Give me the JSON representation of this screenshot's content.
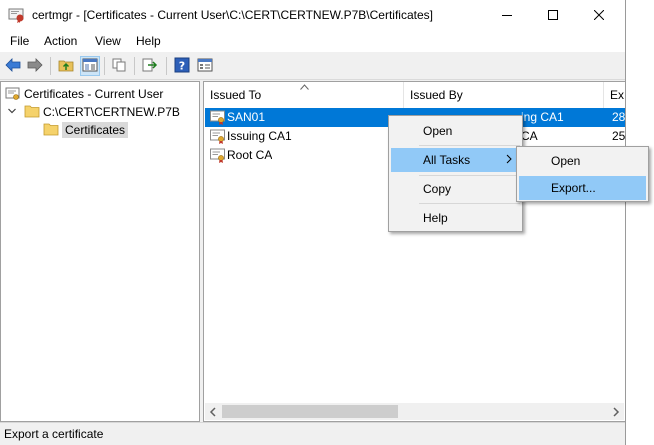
{
  "window": {
    "title": "certmgr - [Certificates - Current User\\C:\\CERT\\CERTNEW.P7B\\Certificates]",
    "controls": [
      "minimize-icon",
      "maximize-icon",
      "close-icon"
    ]
  },
  "menubar": {
    "items": [
      "File",
      "Action",
      "View",
      "Help"
    ]
  },
  "toolbar": {
    "buttons": [
      "back-arrow-icon",
      "forward-arrow-icon",
      "up-folder-icon",
      "show-hide-tree-icon",
      "copy-icon",
      "export-list-icon",
      "help-icon",
      "properties-view-icon"
    ],
    "pressed": "show-hide-tree-icon"
  },
  "tree": {
    "root": "Certificates - Current User",
    "child": "C:\\CERT\\CERTNEW.P7B",
    "leaf": "Certificates"
  },
  "list": {
    "columns": [
      "Issued To",
      "Issued By",
      "Ex"
    ],
    "rows": [
      {
        "issued_to": "SAN01",
        "issued_by": "ing CA1",
        "expires": "28",
        "selected": true
      },
      {
        "issued_to": "Issuing CA1",
        "issued_by": "CA",
        "expires": "25",
        "selected": false
      },
      {
        "issued_to": "Root CA",
        "issued_by": "",
        "expires": "",
        "selected": false
      }
    ]
  },
  "context_menu": {
    "items": [
      "Open",
      "All Tasks",
      "Copy",
      "Help"
    ],
    "highlighted": "All Tasks"
  },
  "submenu": {
    "items": [
      "Open",
      "Export..."
    ],
    "highlighted": "Export..."
  },
  "status": {
    "text": "Export a certificate"
  },
  "colors": {
    "selection": "#0078d7",
    "menu_highlight": "#91c9f7",
    "pane_border": "#a0a0a0",
    "chrome": "#f0f0f0"
  }
}
